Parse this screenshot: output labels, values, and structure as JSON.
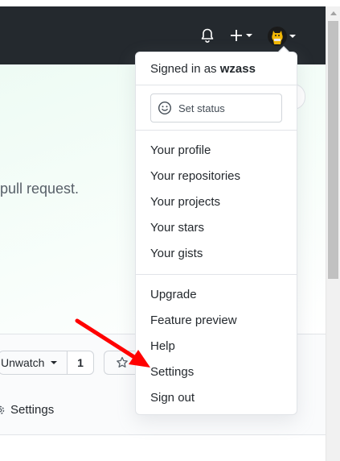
{
  "header": {
    "icons": [
      "bell-icon",
      "plus-icon",
      "chevron-down-icon",
      "avatar"
    ]
  },
  "hero": {
    "text": "pull request."
  },
  "repo": {
    "watch_label": "Unwatch",
    "watch_count": "1",
    "settings_tab": "Settings"
  },
  "menu": {
    "signed_in_prefix": "Signed in as",
    "username": "wzass",
    "set_status": "Set status",
    "items_group1": [
      "Your profile",
      "Your repositories",
      "Your projects",
      "Your stars",
      "Your gists"
    ],
    "items_group2": [
      "Upgrade",
      "Feature preview",
      "Help",
      "Settings",
      "Sign out"
    ]
  },
  "colors": {
    "header_bg": "#24292e",
    "annotation_arrow": "#ff0000",
    "hero_tint": "#eefbf4"
  }
}
